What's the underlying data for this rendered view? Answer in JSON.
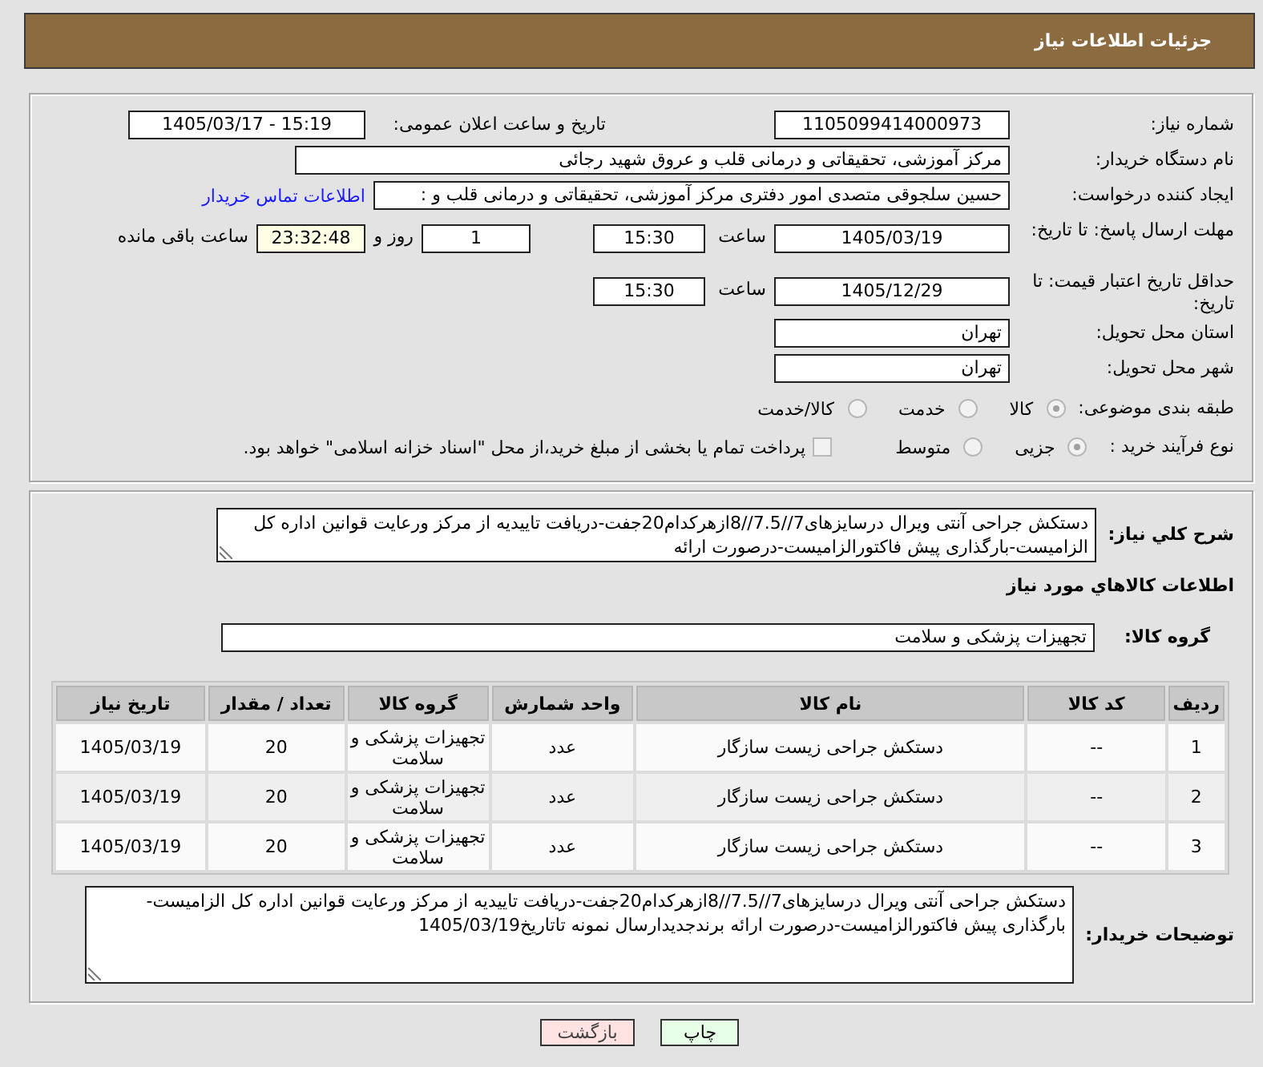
{
  "header": {
    "title": "جزئیات اطلاعات نیاز"
  },
  "need_number": {
    "label": "شماره نیاز:",
    "value": "1105099414000973"
  },
  "announcement": {
    "label": "تاریخ و ساعت اعلان عمومی:",
    "value": "1405/03/17 - 15:19"
  },
  "buyer_organization": {
    "label": "نام دستگاه خریدار:",
    "value": "مرکز آموزشی، تحقیقاتی و درمانی قلب و عروق شهید رجائی"
  },
  "requester": {
    "label": "ایجاد کننده درخواست:",
    "value": "حسین سلجوقی متصدی امور دفتری مرکز آموزشی، تحقیقاتی و درمانی قلب و :",
    "contact_link": "اطلاعات تماس خریدار"
  },
  "response_deadline": {
    "label": "مهلت ارسال پاسخ: تا تاریخ:",
    "date": "1405/03/19",
    "time_label": "ساعت",
    "time": "15:30",
    "days": "1",
    "days_label": "روز و",
    "remaining": "23:32:48",
    "remaining_label": "ساعت باقی مانده"
  },
  "price_validity": {
    "label": "حداقل تاریخ اعتبار قیمت: تا تاریخ:",
    "date": "1405/12/29",
    "time_label": "ساعت",
    "time": "15:30"
  },
  "delivery_province": {
    "label": "استان محل تحویل:",
    "value": "تهران"
  },
  "delivery_city": {
    "label": "شهر محل تحویل:",
    "value": "تهران"
  },
  "subject_category": {
    "label": "طبقه بندی موضوعی:",
    "options": [
      {
        "label": "کالا",
        "selected": true,
        "disabled": true
      },
      {
        "label": "خدمت",
        "selected": false,
        "disabled": true
      },
      {
        "label": "کالا/خدمت",
        "selected": false,
        "disabled": true
      }
    ]
  },
  "purchase_process": {
    "label": "نوع فرآیند خرید :",
    "options": [
      {
        "label": "جزیی",
        "selected": true,
        "disabled": true
      },
      {
        "label": "متوسط",
        "selected": false,
        "disabled": true
      }
    ],
    "treasury_payment": {
      "label": "پرداخت تمام یا بخشی از مبلغ خرید،از محل \"اسناد خزانه اسلامی\" خواهد بود.",
      "checked": false,
      "disabled": true
    }
  },
  "general_description": {
    "label": "شرح کلي نیاز:",
    "value": "دستکش جراحی آنتی ویرال درسایزهای7//7.5//8ازهرکدام20جفت-دریافت تاییدیه از مرکز ورعایت قوانین اداره کل الزامیست-بارگذاری پیش فاکتورالزامیست-درصورت ارائه"
  },
  "goods_section": {
    "title": "اطلاعات کالاهاي مورد نیاز",
    "group_label": "گروه کالا:",
    "group_value": "تجهیزات پزشکی و سلامت"
  },
  "table": {
    "columns": [
      "ردیف",
      "کد کالا",
      "نام کالا",
      "واحد شمارش",
      "گروه کالا",
      "تعداد / مقدار",
      "تاریخ نیاز"
    ],
    "rows": [
      [
        "1",
        "--",
        "دستکش جراحی زیست سازگار",
        "عدد",
        "تجهیزات پزشکی و سلامت",
        "20",
        "1405/03/19"
      ],
      [
        "2",
        "--",
        "دستکش جراحی زیست سازگار",
        "عدد",
        "تجهیزات پزشکی و سلامت",
        "20",
        "1405/03/19"
      ],
      [
        "3",
        "--",
        "دستکش جراحی زیست سازگار",
        "عدد",
        "تجهیزات پزشکی و سلامت",
        "20",
        "1405/03/19"
      ]
    ]
  },
  "buyer_notes": {
    "label": "توضیحات خریدار:",
    "value": "دستکش جراحی آنتی ویرال درسایزهای7//7.5//8ازهرکدام20جفت-دریافت تاییدیه از مرکز ورعایت قوانین اداره کل الزامیست-بارگذاری پیش فاکتورالزامیست-درصورت ارائه برندجدیدارسال نمونه تاتاریخ1405/03/19"
  },
  "buttons": [
    {
      "label": "چاپ",
      "kind": "print"
    },
    {
      "label": "بازگشت",
      "kind": "back"
    }
  ]
}
